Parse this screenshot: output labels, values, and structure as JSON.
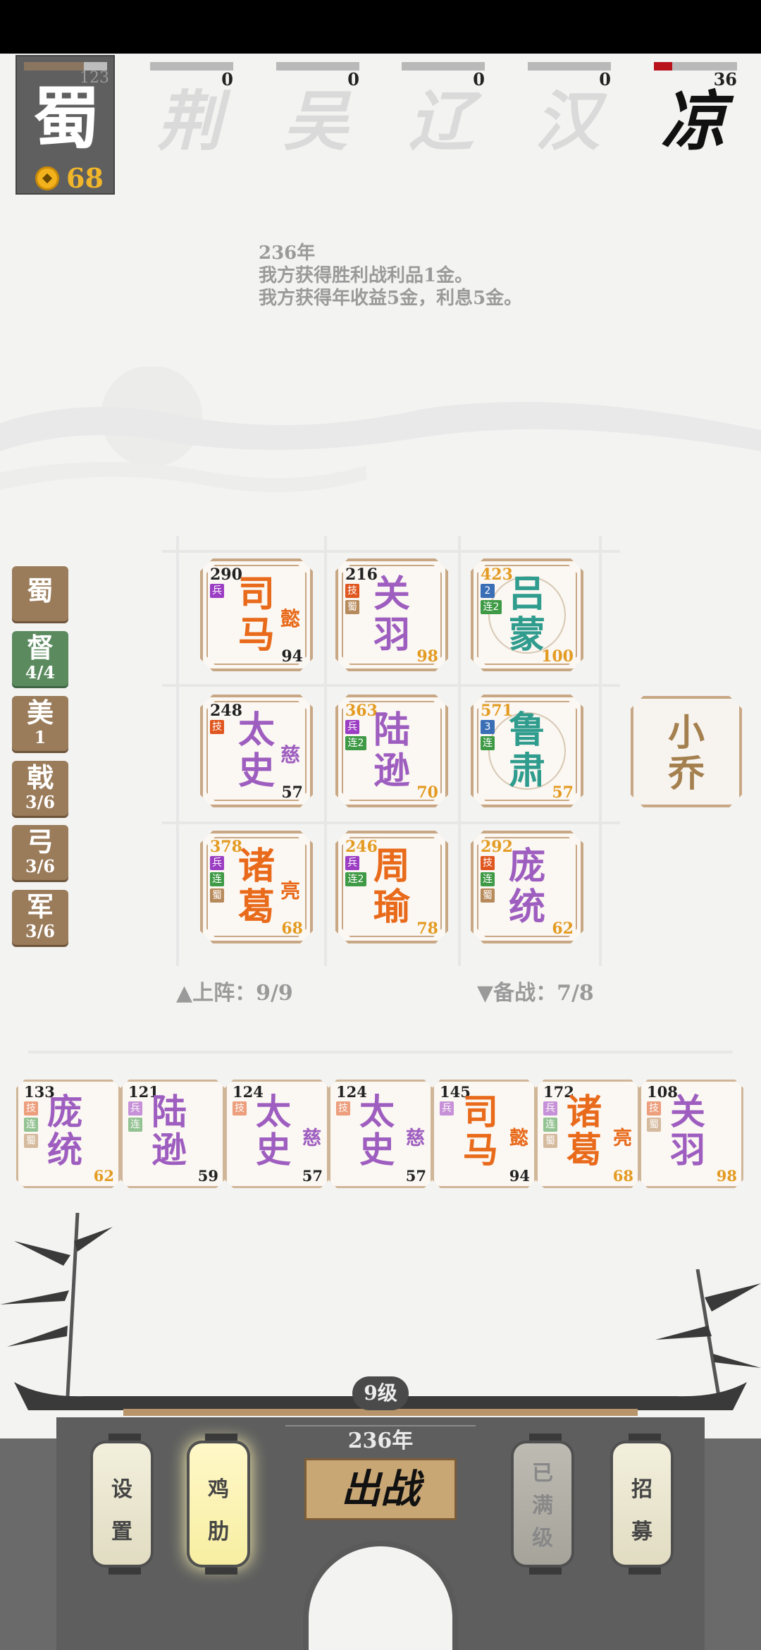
{
  "player": {
    "name": "蜀",
    "hp": "123",
    "hp_fraction": 0.72,
    "gold": "68"
  },
  "enemies": [
    {
      "name": "荆",
      "value": "0",
      "fill_fraction": 0
    },
    {
      "name": "吴",
      "value": "0",
      "fill_fraction": 0
    },
    {
      "name": "辽",
      "value": "0",
      "fill_fraction": 0
    },
    {
      "name": "汉",
      "value": "0",
      "fill_fraction": 0
    },
    {
      "name": "凉",
      "value": "36",
      "fill_fraction": 0.22
    }
  ],
  "log": [
    "236年",
    "我方获得胜利战利品1金。",
    "我方获得年收益5金，利息5金。"
  ],
  "side_tags": [
    {
      "title": "蜀",
      "count": ""
    },
    {
      "title": "督",
      "count": "4/4"
    },
    {
      "title": "美",
      "count": "1"
    },
    {
      "title": "戟",
      "count": "3/6"
    },
    {
      "title": "弓",
      "count": "3/6"
    },
    {
      "title": "军",
      "count": "3/6"
    }
  ],
  "board": [
    {
      "hp": "290",
      "name": "司马",
      "sub": "懿",
      "level": "94",
      "badges": [
        "兵"
      ]
    },
    {
      "hp": "216",
      "name": "关羽",
      "sub": "",
      "level": "98",
      "badges": [
        "技",
        "蜀"
      ]
    },
    {
      "hp": "423",
      "name": "吕蒙",
      "sub": "",
      "level": "100",
      "badges": [
        "2",
        "连2"
      ]
    },
    {
      "hp": "248",
      "name": "太史",
      "sub": "慈",
      "level": "57",
      "badges": [
        "技"
      ]
    },
    {
      "hp": "363",
      "name": "陆逊",
      "sub": "",
      "level": "70",
      "badges": [
        "兵",
        "连2"
      ]
    },
    {
      "hp": "571",
      "name": "鲁肃",
      "sub": "",
      "level": "57",
      "badges": [
        "3",
        "连"
      ]
    },
    {
      "hp": "378",
      "name": "诸葛",
      "sub": "亮",
      "level": "68",
      "badges": [
        "兵",
        "连",
        "蜀"
      ]
    },
    {
      "hp": "246",
      "name": "周瑜",
      "sub": "",
      "level": "78",
      "badges": [
        "兵",
        "连2"
      ]
    },
    {
      "hp": "292",
      "name": "庞统",
      "sub": "",
      "level": "62",
      "badges": [
        "技",
        "连",
        "蜀"
      ]
    }
  ],
  "reserve_card": "小乔",
  "deployed": "▲上阵：9/9",
  "standby": "▼备战：7/8",
  "bench": [
    {
      "hp": "133",
      "name": "庞统",
      "sub": "",
      "level": "62",
      "badges": [
        "技",
        "连",
        "蜀"
      ]
    },
    {
      "hp": "121",
      "name": "陆逊",
      "sub": "",
      "level": "59",
      "badges": [
        "兵",
        "连"
      ]
    },
    {
      "hp": "124",
      "name": "太史",
      "sub": "慈",
      "level": "57",
      "badges": [
        "技"
      ]
    },
    {
      "hp": "124",
      "name": "太史",
      "sub": "慈",
      "level": "57",
      "badges": [
        "技"
      ]
    },
    {
      "hp": "145",
      "name": "司马",
      "sub": "懿",
      "level": "94",
      "badges": [
        "兵"
      ]
    },
    {
      "hp": "172",
      "name": "诸葛",
      "sub": "亮",
      "level": "68",
      "badges": [
        "兵",
        "连",
        "蜀"
      ]
    },
    {
      "hp": "108",
      "name": "关羽",
      "sub": "",
      "level": "98",
      "badges": [
        "技",
        "蜀"
      ]
    }
  ],
  "footer": {
    "level": "9级",
    "year": "236年",
    "settings": "设置",
    "rib": "鸡肋",
    "maxed": "已满级",
    "fight": "出战",
    "recruit": "招募"
  },
  "colors": {
    "accent_orange": "#e86a1a",
    "accent_purple": "#9e5ec0",
    "accent_teal": "#2f9c8e",
    "gold": "#f1b62a",
    "card_border": "#c8a784"
  }
}
